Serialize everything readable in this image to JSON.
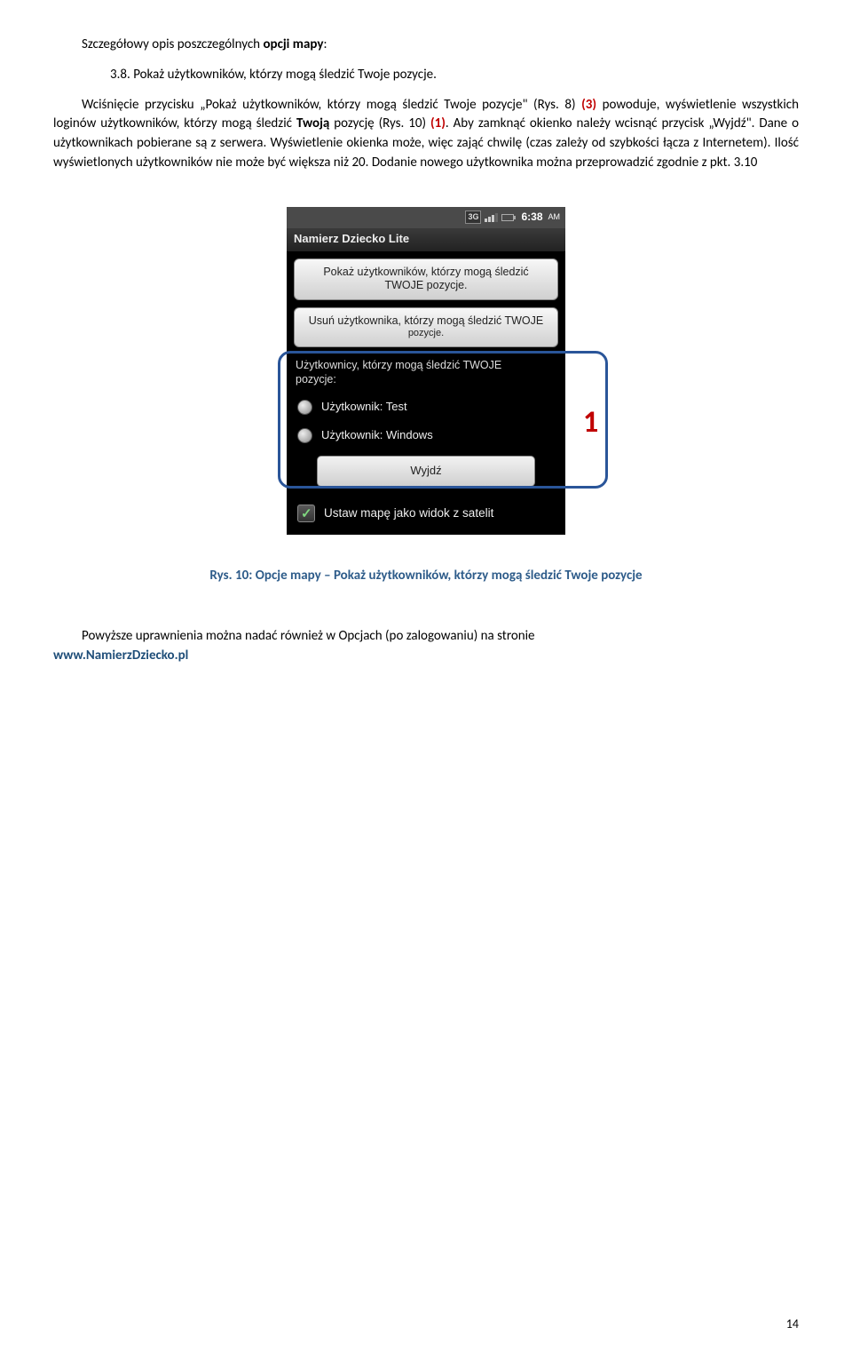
{
  "doc": {
    "heading_prefix": "Szczegółowy opis poszczególnych ",
    "heading_bold": "opcji mapy",
    "heading_suffix": ":",
    "sec_num": "3.8.",
    "sec_title": "Pokaż użytkowników, którzy mogą śledzić Twoje pozycje.",
    "para1_a": "Wciśnięcie przycisku „Pokaż użytkowników, którzy mogą śledzić Twoje pozycje\" (Rys. 8) ",
    "para1_red1": "(3)",
    "para1_b": " powoduje, wyświetlenie wszystkich loginów użytkowników, którzy mogą śledzić ",
    "para1_bold1": "Twoją",
    "para1_c": " pozycję (Rys. 10) ",
    "para1_red2": "(1)",
    "para1_d": ". Aby zamknąć okienko należy wcisnąć przycisk „Wyjdź\". Dane o użytkownikach pobierane są z serwera. Wyświetlenie okienka może, więc zająć chwilę (czas zależy od szybkości łącza z Internetem). Ilość wyświetlonych użytkowników nie może być większa niż 20. Dodanie nowego użytkownika można przeprowadzić zgodnie z pkt. 3.10",
    "caption": "Rys. 10: Opcje mapy – Pokaż użytkowników, którzy mogą śledzić Twoje pozycje",
    "para2_a": "Powyższe uprawnienia można nadać również w Opcjach (po zalogowaniu) na stronie ",
    "para2_link": "www.NamierzDziecko.pl",
    "callout": "1",
    "page_num": "14"
  },
  "phone": {
    "status": {
      "net": "3G",
      "time": "6:38",
      "ampm": "AM"
    },
    "app_title": "Namierz Dziecko Lite",
    "btn1_l1": "Pokaż użytkowników, którzy mogą śledzić",
    "btn1_l2": "TWOJE pozycje.",
    "btn2_l1": "Usuń użytkownika, którzy mogą śledzić TWOJE",
    "btn2_l2": "pozycje.",
    "section_l1": "Użytkownicy, którzy mogą śledzić TWOJE",
    "section_l2": "pozycje:",
    "user1": "Użytkownik: Test",
    "user2": "Użytkownik: Windows",
    "exit": "Wyjdź",
    "sat": "Ustaw mapę jako widok z satelit"
  }
}
